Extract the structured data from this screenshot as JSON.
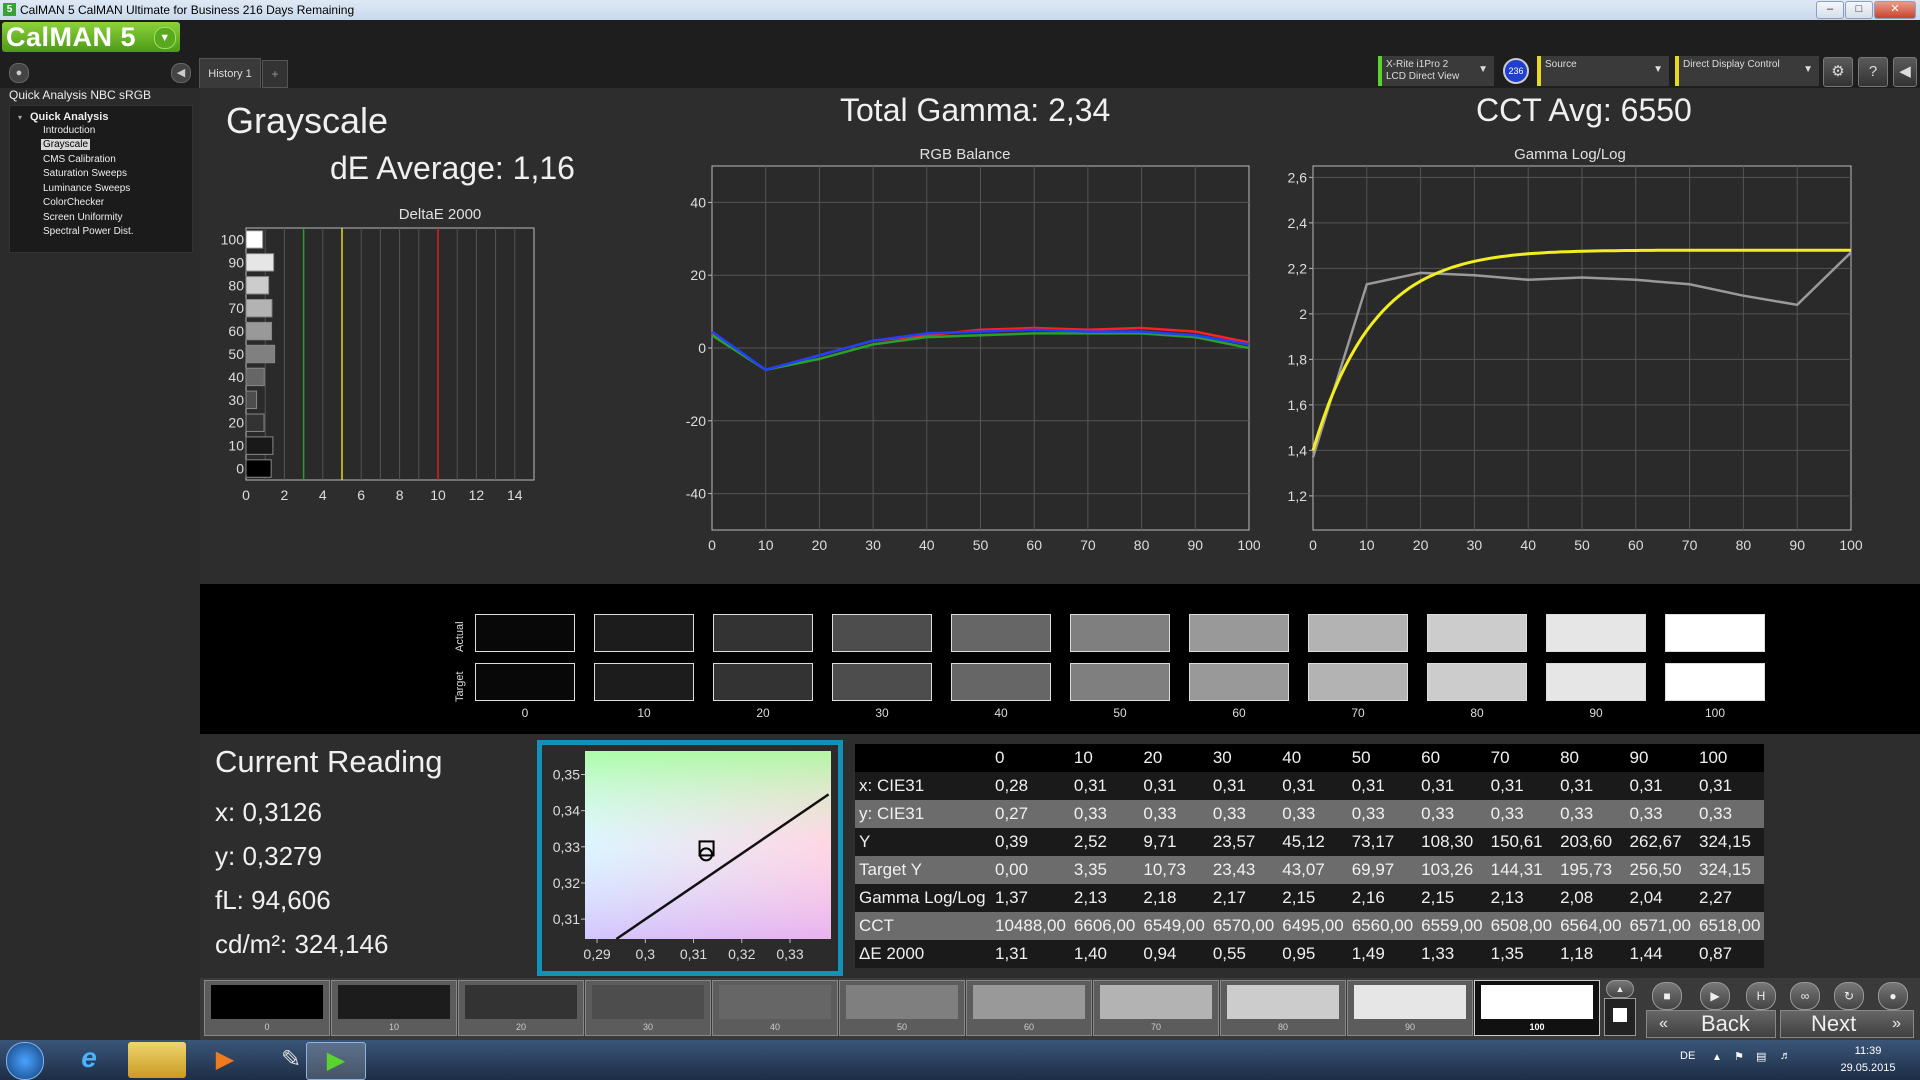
{
  "window": {
    "title": "CalMAN 5 CalMAN Ultimate for Business 216 Days Remaining",
    "app_icon": "5"
  },
  "header": {
    "logo": "CalMAN 5",
    "history_tab": "History 1",
    "history_add": "+",
    "meter": {
      "line1": "X-Rite i1Pro 2",
      "line2": "LCD Direct View",
      "badge": "236"
    },
    "source": {
      "label": "Source"
    },
    "display": {
      "label": "Direct Display Control"
    }
  },
  "sidebar": {
    "title": "Quick Analysis NBC sRGB",
    "root": "Quick Analysis",
    "items": [
      "Introduction",
      "Grayscale",
      "CMS Calibration",
      "Saturation Sweeps",
      "Luminance Sweeps",
      "ColorChecker",
      "Screen Uniformity",
      "Spectral Power Dist."
    ],
    "selected": "Grayscale"
  },
  "page": {
    "title": "Grayscale",
    "de_average": "dE Average: 1,16",
    "total_gamma": "Total Gamma: 2,34",
    "cct_avg": "CCT Avg: 6550"
  },
  "chart_data": [
    {
      "type": "bar",
      "title": "DeltaE 2000",
      "orientation": "horizontal",
      "categories": [
        "100",
        "90",
        "80",
        "70",
        "60",
        "50",
        "40",
        "30",
        "20",
        "10",
        "0"
      ],
      "values": [
        0.87,
        1.44,
        1.18,
        1.35,
        1.33,
        1.49,
        0.95,
        0.55,
        0.94,
        1.4,
        1.31
      ],
      "xlim": [
        0,
        15
      ],
      "xticks": [
        "0",
        "2",
        "4",
        "6",
        "8",
        "10",
        "12",
        "14"
      ],
      "thresholds": [
        {
          "x": 3,
          "color": "#2f9a2f"
        },
        {
          "x": 5,
          "color": "#e6d620"
        },
        {
          "x": 10,
          "color": "#d42020"
        }
      ]
    },
    {
      "type": "line",
      "title": "RGB Balance",
      "x": [
        0,
        10,
        20,
        30,
        40,
        50,
        60,
        70,
        80,
        90,
        100
      ],
      "ylim": [
        -50,
        50
      ],
      "yticks": [
        "40",
        "20",
        "0",
        "-20",
        "-40"
      ],
      "xticks": [
        "0",
        "10",
        "20",
        "30",
        "40",
        "50",
        "60",
        "70",
        "80",
        "90",
        "100"
      ],
      "series": [
        {
          "color": "#ff2020",
          "values": [
            4,
            -6,
            -2,
            2,
            3.5,
            5,
            5.5,
            5,
            5.5,
            4.5,
            1.5
          ]
        },
        {
          "color": "#2aa02a",
          "values": [
            3.5,
            -6,
            -3,
            1,
            3,
            3.5,
            4,
            4,
            4,
            3,
            0
          ]
        },
        {
          "color": "#2040ff",
          "values": [
            4.5,
            -6,
            -2,
            2,
            4,
            4.5,
            5,
            4.5,
            4.5,
            3.5,
            1
          ]
        }
      ]
    },
    {
      "type": "line",
      "title": "Gamma Log/Log",
      "x": [
        0,
        10,
        20,
        30,
        40,
        50,
        60,
        70,
        80,
        90,
        100
      ],
      "ylim": [
        1.05,
        2.65
      ],
      "yticks": [
        "2,6",
        "2,4",
        "2,2",
        "2",
        "1,8",
        "1,6",
        "1,4",
        "1,2"
      ],
      "xticks": [
        "0",
        "10",
        "20",
        "30",
        "40",
        "50",
        "60",
        "70",
        "80",
        "90",
        "100"
      ],
      "series": [
        {
          "color": "#9a9a9a",
          "values": [
            1.37,
            2.13,
            2.18,
            2.17,
            2.15,
            2.16,
            2.15,
            2.13,
            2.08,
            2.04,
            2.27
          ]
        },
        {
          "color": "#f2ee20",
          "curve": "gamma-target",
          "values": [
            1.4,
            2.0,
            2.12,
            2.18,
            2.21,
            2.23,
            2.245,
            2.255,
            2.265,
            2.27,
            2.28
          ]
        }
      ]
    },
    {
      "type": "scatter",
      "title": "CIE xy",
      "xticks": [
        "0,29",
        "0,3",
        "0,31",
        "0,32",
        "0,33"
      ],
      "yticks": [
        "0,35",
        "0,34",
        "0,33",
        "0,32",
        "0,31"
      ],
      "xlim": [
        0.2875,
        0.3385
      ],
      "ylim": [
        0.3045,
        0.3565
      ],
      "target": {
        "x": 0.3127,
        "y": 0.329
      },
      "reading": {
        "x": 0.3126,
        "y": 0.3279
      }
    }
  ],
  "swatches": {
    "row_actual": "Actual",
    "row_target": "Target",
    "labels": [
      "0",
      "10",
      "20",
      "30",
      "40",
      "50",
      "60",
      "70",
      "80",
      "90",
      "100"
    ],
    "actual": [
      "#080808",
      "#1c1c1c",
      "#333333",
      "#4d4d4d",
      "#666666",
      "#7f7f7f",
      "#999999",
      "#b3b3b3",
      "#cccccc",
      "#e6e6e6",
      "#ffffff"
    ],
    "target": [
      "#080808",
      "#1c1c1c",
      "#333333",
      "#4d4d4d",
      "#666666",
      "#7f7f7f",
      "#999999",
      "#b3b3b3",
      "#cccccc",
      "#e6e6e6",
      "#ffffff"
    ]
  },
  "current_reading": {
    "title": "Current Reading",
    "x": "x: 0,3126",
    "y": "y: 0,3279",
    "fl": "fL: 94,606",
    "cdm2": "cd/m²: 324,146"
  },
  "table": {
    "columns": [
      "0",
      "10",
      "20",
      "30",
      "40",
      "50",
      "60",
      "70",
      "80",
      "90",
      "100"
    ],
    "rows": [
      {
        "label": "x: CIE31",
        "values": [
          "0,28",
          "0,31",
          "0,31",
          "0,31",
          "0,31",
          "0,31",
          "0,31",
          "0,31",
          "0,31",
          "0,31",
          "0,31"
        ]
      },
      {
        "label": "y: CIE31",
        "values": [
          "0,27",
          "0,33",
          "0,33",
          "0,33",
          "0,33",
          "0,33",
          "0,33",
          "0,33",
          "0,33",
          "0,33",
          "0,33"
        ]
      },
      {
        "label": "Y",
        "values": [
          "0,39",
          "2,52",
          "9,71",
          "23,57",
          "45,12",
          "73,17",
          "108,30",
          "150,61",
          "203,60",
          "262,67",
          "324,15"
        ]
      },
      {
        "label": "Target Y",
        "values": [
          "0,00",
          "3,35",
          "10,73",
          "23,43",
          "43,07",
          "69,97",
          "103,26",
          "144,31",
          "195,73",
          "256,50",
          "324,15"
        ]
      },
      {
        "label": "Gamma Log/Log",
        "values": [
          "1,37",
          "2,13",
          "2,18",
          "2,17",
          "2,15",
          "2,16",
          "2,15",
          "2,13",
          "2,08",
          "2,04",
          "2,27"
        ]
      },
      {
        "label": "CCT",
        "values": [
          "10488,00",
          "6606,00",
          "6549,00",
          "6570,00",
          "6495,00",
          "6560,00",
          "6559,00",
          "6508,00",
          "6564,00",
          "6571,00",
          "6518,00"
        ]
      },
      {
        "label": "ΔE 2000",
        "values": [
          "1,31",
          "1,40",
          "0,94",
          "0,55",
          "0,95",
          "1,49",
          "1,33",
          "1,35",
          "1,18",
          "1,44",
          "0,87"
        ]
      }
    ]
  },
  "bottom": {
    "swatch_labels": [
      "0",
      "10",
      "20",
      "30",
      "40",
      "50",
      "60",
      "70",
      "80",
      "90",
      "100"
    ],
    "swatch_colors": [
      "#000000",
      "#1c1c1c",
      "#333333",
      "#4d4d4d",
      "#666666",
      "#7f7f7f",
      "#999999",
      "#b3b3b3",
      "#cccccc",
      "#e6e6e6",
      "#ffffff"
    ],
    "selected": "100",
    "back": "Back",
    "next": "Next"
  },
  "taskbar": {
    "lang": "DE",
    "time": "11:39",
    "date": "29.05.2015"
  }
}
